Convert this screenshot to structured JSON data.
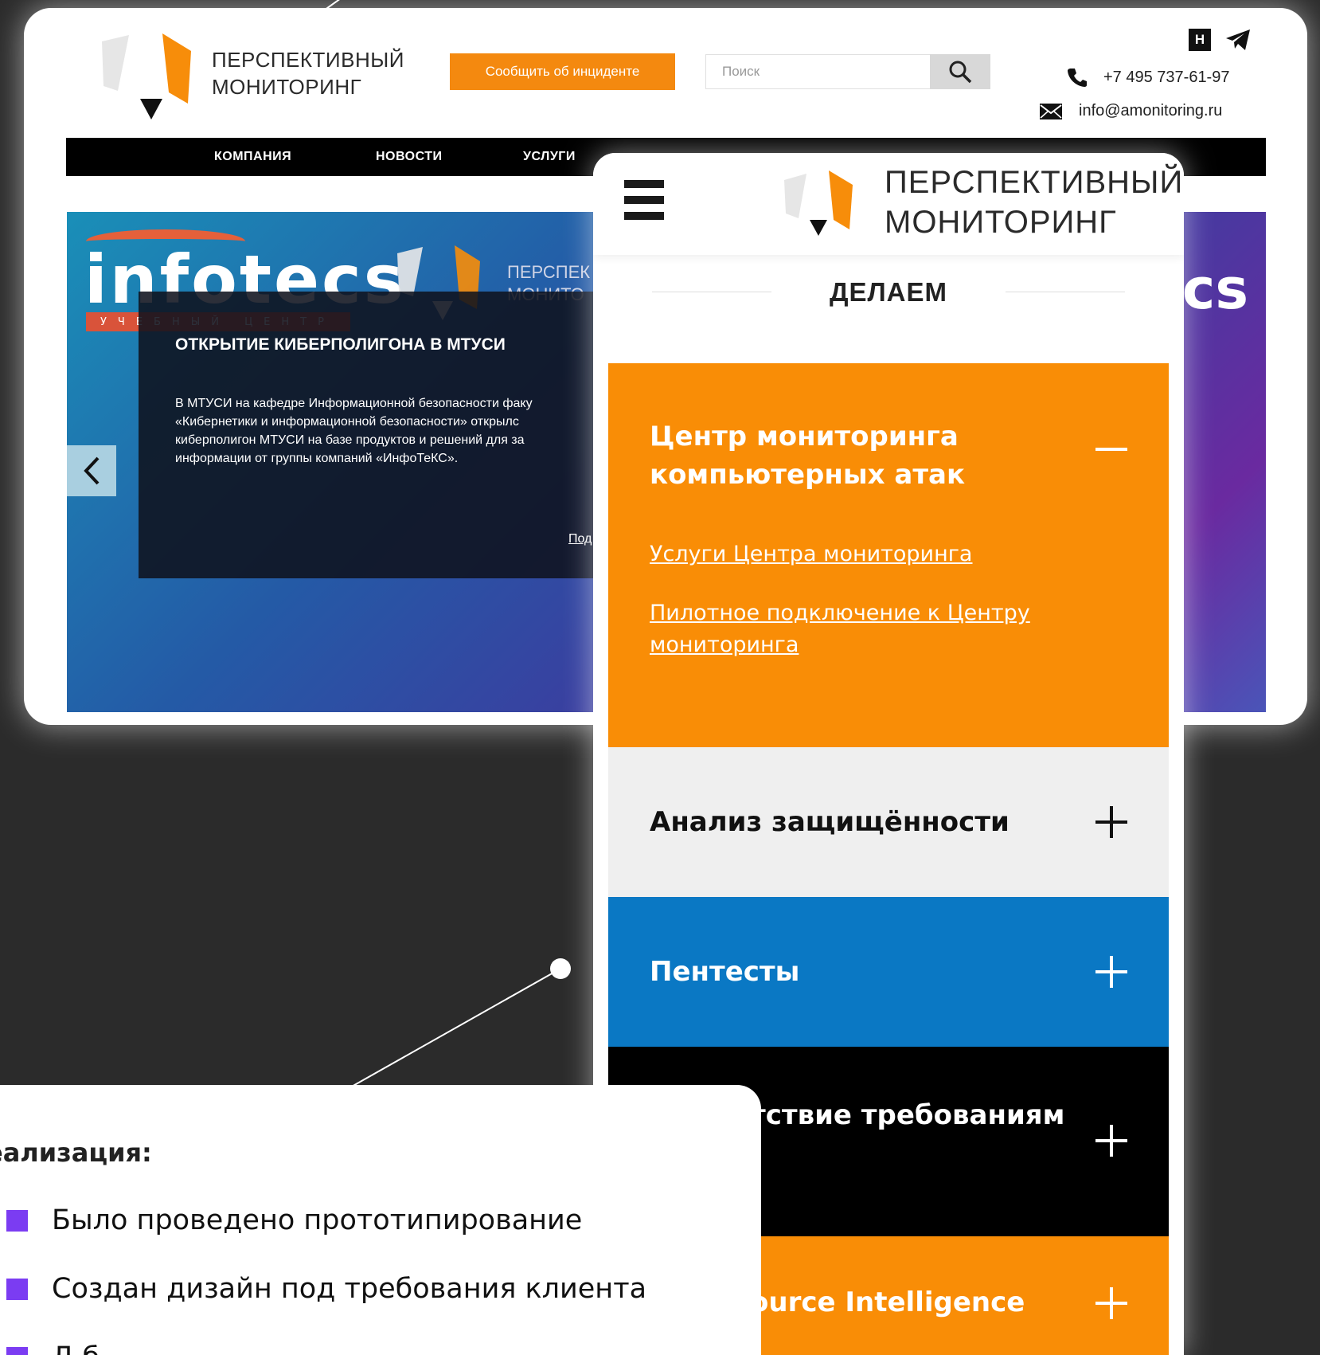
{
  "desktop": {
    "brand": [
      "ПЕРСПЕКТИВНЫЙ",
      "МОНИТОРИНГ"
    ],
    "report_button": "Сообщить об инциденте",
    "search_placeholder": "Поиск",
    "social": {
      "hh_label": "H"
    },
    "phone": "+7 495 737-61-97",
    "email": "info@amonitoring.ru",
    "nav": [
      "КОМПАНИЯ",
      "НОВОСТИ",
      "УСЛУГИ"
    ],
    "slider": {
      "infotecs_word": "infotecs",
      "infotecs_bar": "УЧЕБНЫЙ ЦЕНТР",
      "infotecs_right": "cs",
      "slide_brand": [
        "ПЕРСПЕК",
        "МОНИТО"
      ],
      "news_title": "ОТКРЫТИЕ КИБЕРПОЛИГОНА В МТУСИ",
      "news_body": [
        "В МТУСИ на кафедре Информационной безопасности факу",
        "«Кибернетики и информационной безопасности» открылс",
        "киберполигон МТУСИ на базе продуктов и решений для за",
        "информации от группы компаний «ИнфоТеКС»."
      ],
      "news_more": "Под"
    }
  },
  "mobile": {
    "brand": [
      "ПЕРСПЕКТИВНЫЙ",
      "МОНИТОРИНГ"
    ],
    "section_title": "ДЕЛАЕМ",
    "accordion": [
      {
        "title": [
          "Центр мониторинга",
          "компьютерных атак"
        ],
        "state": "expanded",
        "links": [
          [
            "Услуги Центра мониторинга"
          ],
          [
            "Пилотное подключение к Центру",
            "мониторинга"
          ]
        ]
      },
      {
        "title": "Анализ защищённости",
        "state": "collapsed"
      },
      {
        "title": "Пентесты",
        "state": "collapsed"
      },
      {
        "title": "тствие требованиям",
        "state": "collapsed"
      },
      {
        "title": "ource Intelligence",
        "state": "collapsed"
      }
    ],
    "colors": {
      "orange": "#f98d06",
      "blue": "#0a78c4",
      "gray": "#efefef",
      "black": "#000000"
    }
  },
  "implementation": {
    "heading": "еализация:",
    "items": [
      "Было проведено прототипирование",
      "Создан дизайн под требования клиента",
      "Д б"
    ],
    "bullet_color": "#7b3cf2"
  }
}
